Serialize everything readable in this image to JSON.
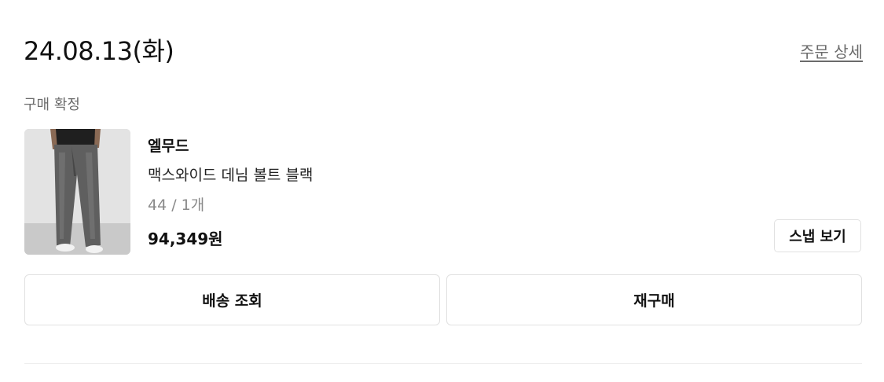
{
  "order": {
    "date": "24.08.13(화)",
    "detail_link": "주문 상세",
    "status": "구매 확정"
  },
  "product": {
    "brand": "엘무드",
    "name": "맥스와이드 데님 볼트 블랙",
    "option": "44 / 1개",
    "price": "94,349원",
    "image_alt": "맥스와이드 데님 볼트 블랙"
  },
  "buttons": {
    "snap": "스냅 보기",
    "delivery": "배송 조회",
    "reorder": "재구매"
  },
  "colors": {
    "text_primary": "#111111",
    "text_secondary": "#6b6b6b",
    "text_muted": "#8a8a8a",
    "border": "#e1e1e1"
  }
}
